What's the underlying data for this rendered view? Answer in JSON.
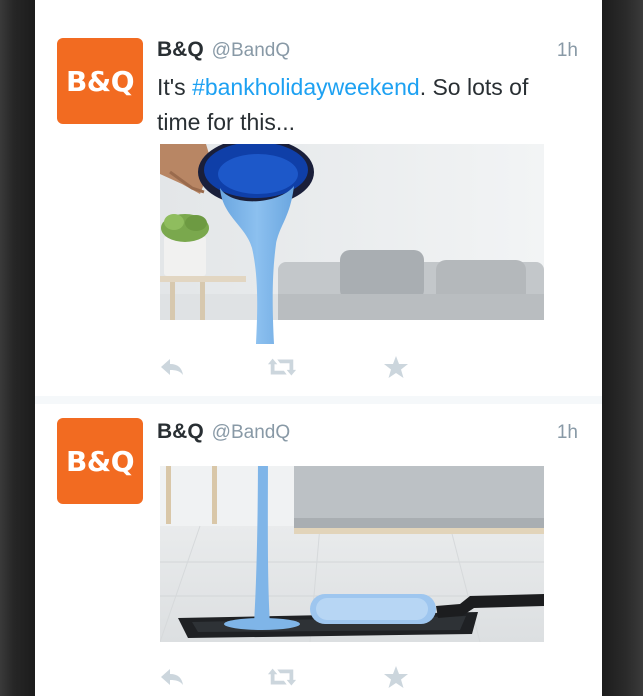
{
  "tweets": [
    {
      "avatar_text": "B&Q",
      "display_name": "B&Q",
      "handle": "@BandQ",
      "time": "1h",
      "text_before": "It's ",
      "hashtag": "#bankholidayweekend",
      "text_after": ". So lots of time for this...",
      "media_alt": "Blue paint poured from a can into a grey living room"
    },
    {
      "avatar_text": "B&Q",
      "display_name": "B&Q",
      "handle": "@BandQ",
      "time": "1h",
      "media_alt": "Blue paint pouring into a paint tray with a roller"
    }
  ],
  "actions": {
    "reply_icon": "reply-icon",
    "retweet_icon": "retweet-icon",
    "favorite_icon": "star-icon"
  },
  "colors": {
    "brand_orange": "#f26b21",
    "paint_blue": "#7fb5e8",
    "link_blue": "#1da1f2",
    "muted_gray": "#8899a6",
    "icon_gray": "#ccd6dd"
  }
}
